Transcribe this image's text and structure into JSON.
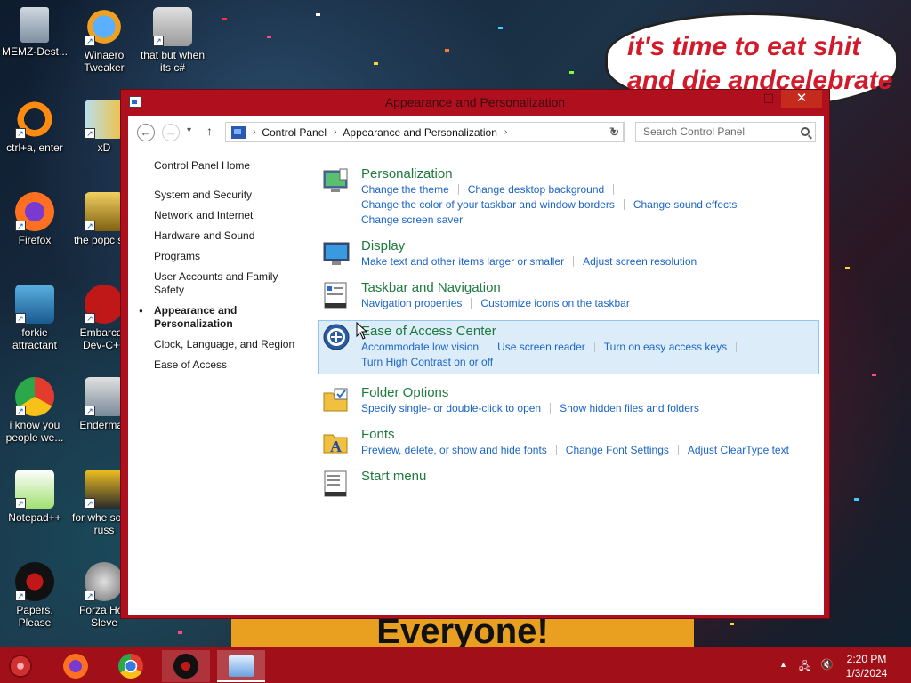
{
  "desktop": {
    "icons": [
      {
        "label": "MEMZ-Dest..."
      },
      {
        "label": "Winaero Tweaker"
      },
      {
        "label": "that but when its c#"
      },
      {
        "label": "ctrl+a, enter"
      },
      {
        "label": "xD"
      },
      {
        "label": "Firefox"
      },
      {
        "label": "the popc shit"
      },
      {
        "label": "forkie attractant"
      },
      {
        "label": "Embarcad Dev-C++"
      },
      {
        "label": "i know you people we..."
      },
      {
        "label": "Enderman"
      },
      {
        "label": "Notepad++"
      },
      {
        "label": "for whe some russ"
      },
      {
        "label": "Papers, Please"
      },
      {
        "label": "Forza Hori Sleve"
      }
    ],
    "wallpaper_text": {
      "bubble": "it's time to eat shit and die andcelebrate",
      "banner": "Everyone!"
    }
  },
  "window": {
    "title": "Appearance and Personalization",
    "close_glyph": "✕",
    "minimize_glyph": "—",
    "maximize_glyph": "☐",
    "nav": {
      "back": "←",
      "forward": "→",
      "recent": "▾",
      "up": "↑",
      "refresh": "↻",
      "breadcrumb": [
        "Control Panel",
        "Appearance and Personalization"
      ],
      "search_placeholder": "Search Control Panel"
    },
    "sidebar": {
      "home": "Control Panel Home",
      "items": [
        "System and Security",
        "Network and Internet",
        "Hardware and Sound",
        "Programs",
        "User Accounts and Family Safety",
        "Appearance and Personalization",
        "Clock, Language, and Region",
        "Ease of Access"
      ],
      "active_index": 5
    },
    "categories": [
      {
        "title": "Personalization",
        "icon": "personalization-icon",
        "links": [
          "Change the theme",
          "Change desktop background",
          "Change the color of your taskbar and window borders",
          "Change sound effects",
          "Change screen saver"
        ]
      },
      {
        "title": "Display",
        "icon": "display-icon",
        "links": [
          "Make text and other items larger or smaller",
          "Adjust screen resolution"
        ]
      },
      {
        "title": "Taskbar and Navigation",
        "icon": "taskbar-icon",
        "links": [
          "Navigation properties",
          "Customize icons on the taskbar"
        ]
      },
      {
        "title": "Ease of Access Center",
        "icon": "ease-of-access-icon",
        "links": [
          "Accommodate low vision",
          "Use screen reader",
          "Turn on easy access keys",
          "Turn High Contrast on or off"
        ]
      },
      {
        "title": "Folder Options",
        "icon": "folder-options-icon",
        "links": [
          "Specify single- or double-click to open",
          "Show hidden files and folders"
        ]
      },
      {
        "title": "Fonts",
        "icon": "fonts-icon",
        "links": [
          "Preview, delete, or show and hide fonts",
          "Change Font Settings",
          "Adjust ClearType text"
        ]
      },
      {
        "title": "Start menu",
        "icon": "start-menu-icon",
        "links": []
      }
    ]
  },
  "taskbar": {
    "time": "2:20 PM",
    "date": "1/3/2024"
  },
  "colors": {
    "window_frame": "#b0101e",
    "taskbar": "#a11018",
    "category_title": "#1e7a3e",
    "link": "#1b64c8",
    "highlight_bg": "#dcecf8"
  }
}
